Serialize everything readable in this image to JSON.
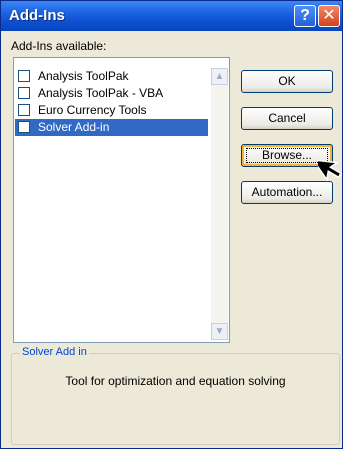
{
  "window": {
    "title": "Add-Ins",
    "help_glyph": "?",
    "close_glyph": "✕"
  },
  "addins": {
    "label": "Add-Ins available:",
    "items": [
      {
        "label": "Analysis ToolPak",
        "checked": false,
        "selected": false
      },
      {
        "label": "Analysis ToolPak - VBA",
        "checked": false,
        "selected": false
      },
      {
        "label": "Euro Currency Tools",
        "checked": false,
        "selected": false
      },
      {
        "label": "Solver Add-in",
        "checked": false,
        "selected": true
      }
    ]
  },
  "buttons": {
    "ok": "OK",
    "cancel": "Cancel",
    "browse": "Browse...",
    "automation": "Automation..."
  },
  "description": {
    "title": "Solver Add in",
    "text": "Tool for optimization and equation solving"
  },
  "icons": {
    "help": "help-icon",
    "close": "close-icon",
    "scroll_up": "chevron-up-icon",
    "scroll_down": "chevron-down-icon",
    "cursor": "mouse-pointer-icon"
  },
  "colors": {
    "titlebar": "#0d4fcf",
    "selection": "#316ac5",
    "group_title": "#0046d5",
    "dialog_bg": "#ece9d8"
  }
}
